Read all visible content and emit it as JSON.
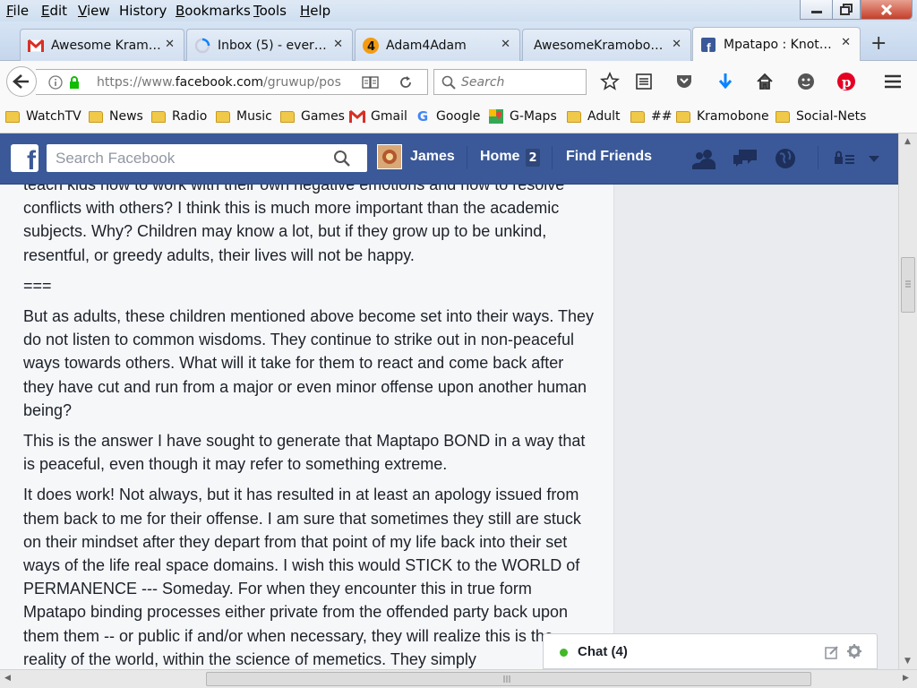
{
  "menubar": {
    "items": [
      {
        "first": "F",
        "rest": "ile"
      },
      {
        "first": "E",
        "rest": "dit"
      },
      {
        "first": "V",
        "rest": "iew"
      },
      {
        "first": "His",
        "rest": "tory",
        "underline_index": 2
      },
      {
        "first": "B",
        "rest": "ookmarks"
      },
      {
        "first": "T",
        "rest": "ools"
      },
      {
        "first": "H",
        "rest": "elp"
      }
    ]
  },
  "tabs": [
    {
      "title": "Awesome Kram…",
      "icon": "gmail-icon",
      "active": false
    },
    {
      "title": "Inbox (5) - ever…",
      "icon": "loading-icon",
      "active": false
    },
    {
      "title": "Adam4Adam",
      "icon": "adam4adam-icon",
      "active": false
    },
    {
      "title": "AwesomeKramobo…",
      "icon": "none",
      "active": false
    },
    {
      "title": "Mpatapo : Knot…",
      "icon": "facebook-icon",
      "active": true
    }
  ],
  "tab_close_glyph": "✕",
  "new_tab_glyph": "+",
  "navbar": {
    "url_prefix": "https://www.",
    "url_domain": "facebook.com",
    "url_suffix": "/gruwup/pos",
    "search_placeholder": "Search"
  },
  "bookmarks": [
    {
      "label": "WatchTV",
      "icon": "folder-icon"
    },
    {
      "label": "News",
      "icon": "folder-icon"
    },
    {
      "label": "Radio",
      "icon": "folder-icon"
    },
    {
      "label": "Music",
      "icon": "folder-icon"
    },
    {
      "label": "Games",
      "icon": "folder-icon"
    },
    {
      "label": "Gmail",
      "icon": "gmail-icon"
    },
    {
      "label": "Google",
      "icon": "google-icon"
    },
    {
      "label": "G-Maps",
      "icon": "maps-icon"
    },
    {
      "label": "Adult",
      "icon": "folder-icon"
    },
    {
      "label": "##",
      "icon": "folder-icon"
    },
    {
      "label": "Kramobone",
      "icon": "folder-icon"
    },
    {
      "label": "Social-Nets",
      "icon": "folder-icon"
    }
  ],
  "facebook": {
    "search_placeholder": "Search Facebook",
    "user_name": "James",
    "home_label": "Home",
    "home_badge": "2",
    "find_friends_label": "Find Friends"
  },
  "post": {
    "paragraphs": [
      "teach kids how to work with their own negative emotions and how to resolve conflicts with others? I think this is much more important than the academic subjects. Why? Children may know a lot, but if they grow up to be unkind, resentful, or greedy adults, their lives will not be happy.",
      "===",
      "But as adults, these children mentioned above become set into their ways. They do not listen to common wisdoms. They continue to strike out in non-peaceful ways towards others. What will it take for them to react and come back after they have cut and run from a major or even minor offense upon another human being?",
      "This is the answer I have sought to generate that Maptapo BOND in a way that is peaceful, even though it may refer to something extreme.",
      "It does work! Not always, but it has resulted in at least an apology issued from them back to me for their offense. I am sure that sometimes they still are stuck on their mindset after they depart from that point of my life back into their set ways of the life real space domains. I wish this would STICK to the WORLD of PERMANENCE --- Someday. For when they encounter this in true form Mpatapo binding processes either private from the offended party back upon them them -- or public if and/or when necessary, they will realize this is the reality of the world, within the science of memetics. They simply"
    ]
  },
  "chat": {
    "label": "Chat (4)"
  },
  "colors": {
    "facebook_blue": "#3b5998",
    "chat_online": "#42b72a"
  }
}
